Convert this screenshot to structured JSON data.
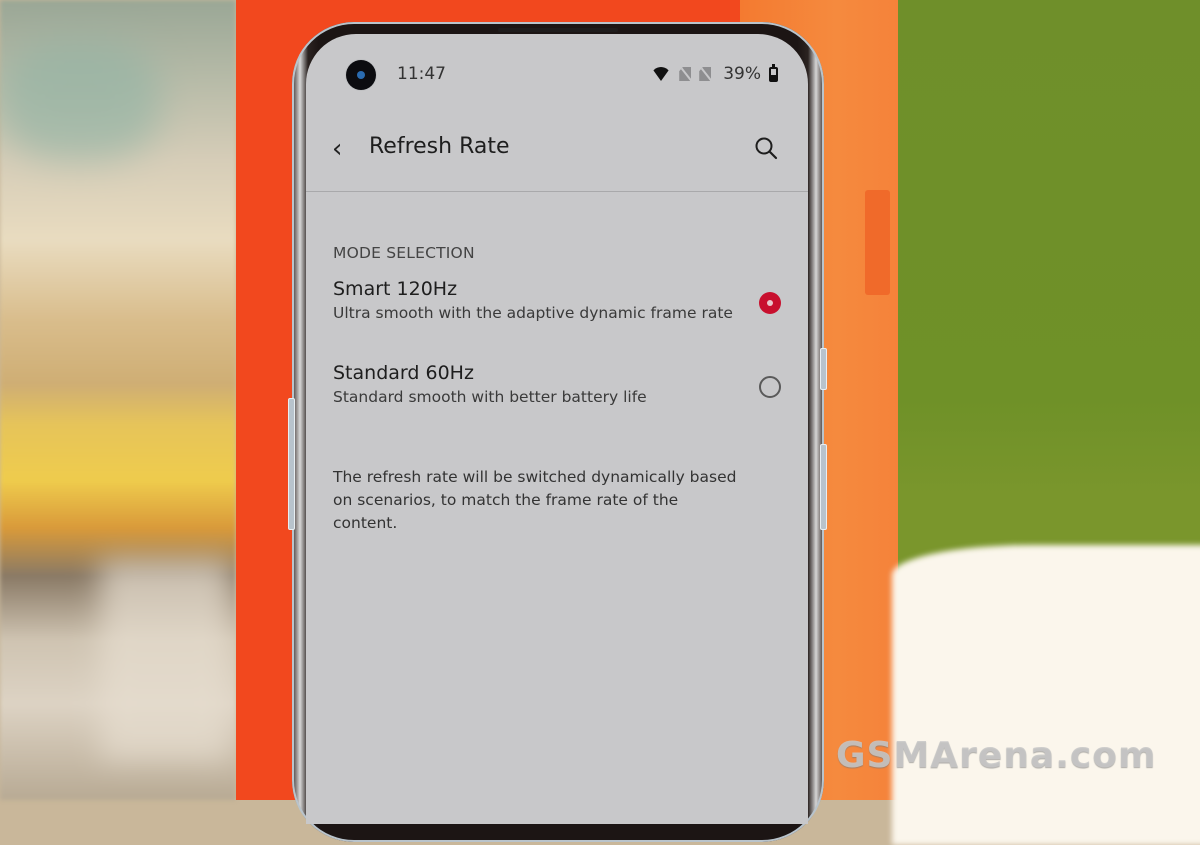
{
  "status_bar": {
    "time": "11:47",
    "battery_percent": "39%",
    "icons": [
      "front-camera",
      "wifi-icon",
      "no-sim-icon",
      "no-sim-icon",
      "battery-icon"
    ]
  },
  "toolbar": {
    "back_icon": "chevron-left-icon",
    "title": "Refresh Rate",
    "search_icon": "search-icon"
  },
  "settings": {
    "section_header": "MODE SELECTION",
    "options": [
      {
        "title": "Smart 120Hz",
        "description": "Ultra smooth with the adaptive dynamic frame rate",
        "selected": true
      },
      {
        "title": "Standard 60Hz",
        "description": "Standard smooth with better battery life",
        "selected": false
      }
    ],
    "footnote": "The refresh rate will be switched dynamically based on scenarios, to match the frame rate of the content."
  },
  "colors": {
    "accent": "#c8102e",
    "screen_bg": "#c8c8ca"
  },
  "watermark": "GSMArena.com"
}
